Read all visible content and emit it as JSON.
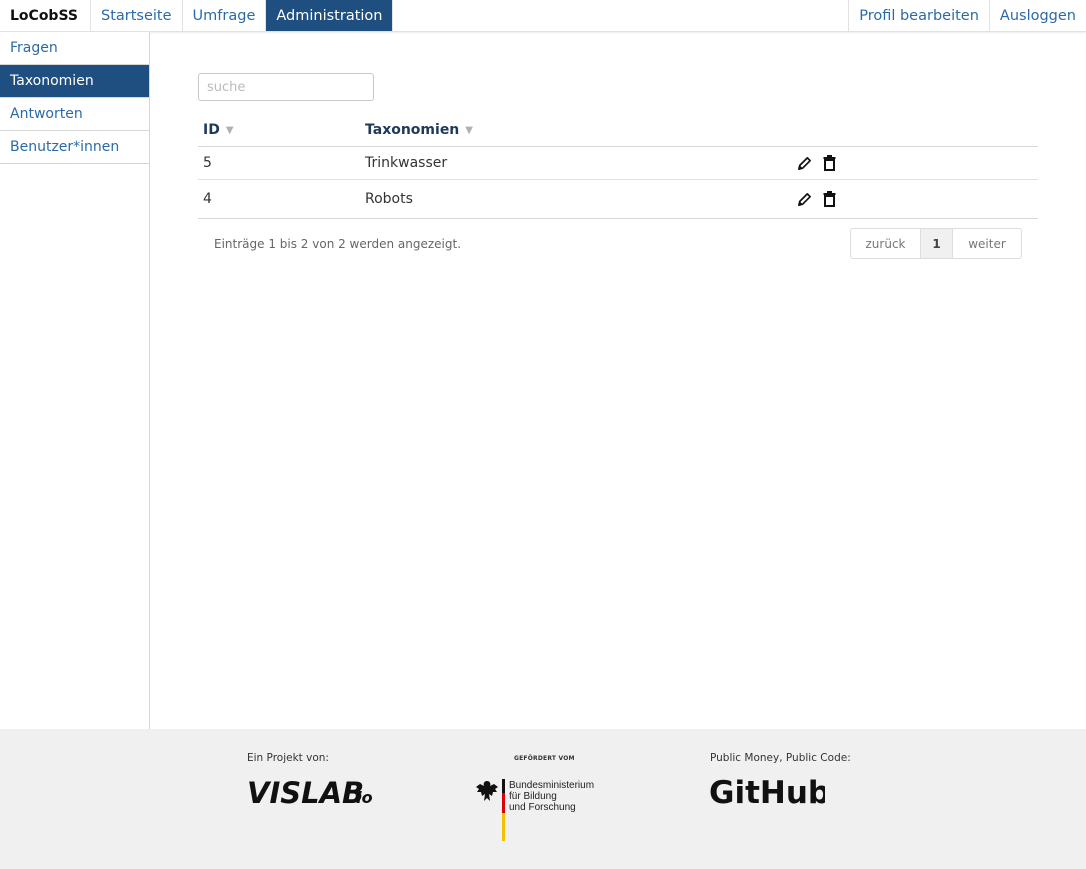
{
  "brand": "LoCobSS",
  "nav": {
    "items": [
      {
        "label": "Startseite",
        "active": false
      },
      {
        "label": "Umfrage",
        "active": false
      },
      {
        "label": "Administration",
        "active": true
      }
    ],
    "right": [
      {
        "label": "Profil bearbeiten"
      },
      {
        "label": "Ausloggen"
      }
    ]
  },
  "sidebar": {
    "items": [
      {
        "label": "Fragen",
        "active": false
      },
      {
        "label": "Taxonomien",
        "active": true
      },
      {
        "label": "Antworten",
        "active": false
      },
      {
        "label": "Benutzer*innen",
        "active": false
      }
    ]
  },
  "search": {
    "placeholder": "suche",
    "value": ""
  },
  "table": {
    "columns": [
      {
        "label": "ID",
        "sort_icon": "sort-down-icon"
      },
      {
        "label": "Taxonomien",
        "sort_icon": "sort-down-icon"
      }
    ],
    "rows": [
      {
        "id": "5",
        "taxonomy": "Trinkwasser"
      },
      {
        "id": "4",
        "taxonomy": "Robots"
      }
    ],
    "row_actions": [
      "pencil-icon",
      "trash-icon"
    ]
  },
  "table_info": "Einträge 1 bis 2 von 2 werden angezeigt.",
  "pagination": {
    "prev": "zurück",
    "current": "1",
    "next": "weiter"
  },
  "footer": {
    "project_label": "Ein Projekt von:",
    "project_logo": "VISLAB.io",
    "funded_label": "GEFÖRDERT VOM",
    "ministry_lines": [
      "Bundesministerium",
      "für Bildung",
      "und Forschung"
    ],
    "code_label": "Public Money, Public Code:",
    "code_logo": "GitHub"
  },
  "colors": {
    "accent": "#1e4f80",
    "link": "#2b6aa8",
    "footer_bg": "#f0f0f0"
  }
}
